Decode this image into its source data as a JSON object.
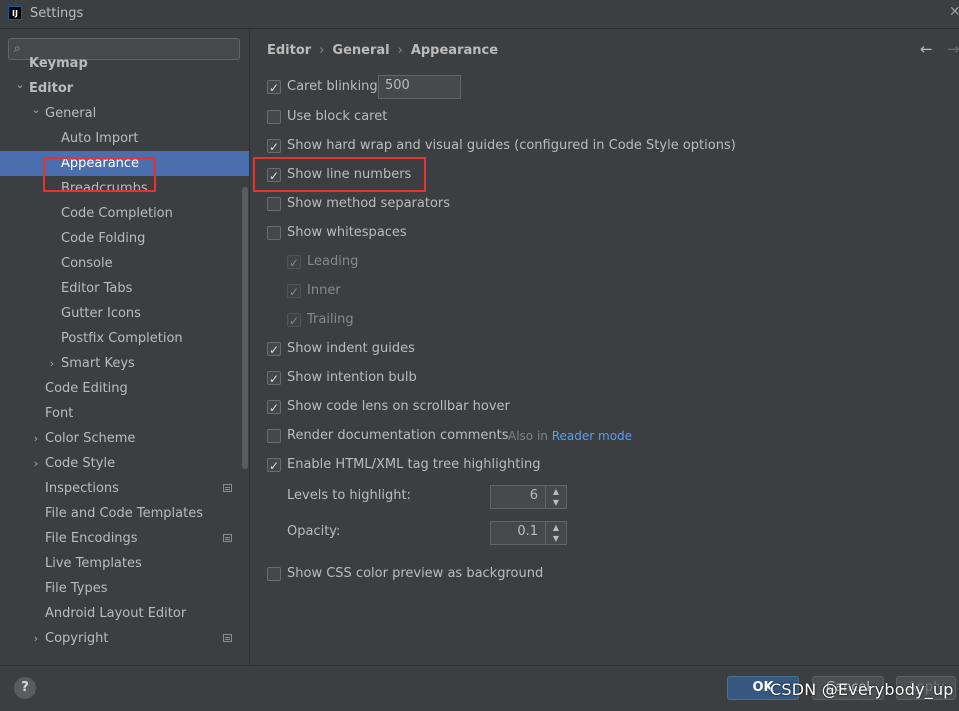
{
  "window": {
    "title": "Settings",
    "icon_text": "IJ"
  },
  "sidebar": {
    "search_placeholder": "",
    "items": [
      {
        "label": "Keymap",
        "bold": true,
        "level": 0,
        "arrow": "",
        "partial": true
      },
      {
        "label": "Editor",
        "bold": true,
        "level": 0,
        "arrow": "down"
      },
      {
        "label": "General",
        "level": 1,
        "arrow": "down"
      },
      {
        "label": "Auto Import",
        "level": 2
      },
      {
        "label": "Appearance",
        "level": 2,
        "selected": true
      },
      {
        "label": "Breadcrumbs",
        "level": 2
      },
      {
        "label": "Code Completion",
        "level": 2
      },
      {
        "label": "Code Folding",
        "level": 2
      },
      {
        "label": "Console",
        "level": 2
      },
      {
        "label": "Editor Tabs",
        "level": 2
      },
      {
        "label": "Gutter Icons",
        "level": 2
      },
      {
        "label": "Postfix Completion",
        "level": 2
      },
      {
        "label": "Smart Keys",
        "level": 2,
        "arrow": "right"
      },
      {
        "label": "Code Editing",
        "level": 1
      },
      {
        "label": "Font",
        "level": 1
      },
      {
        "label": "Color Scheme",
        "level": 1,
        "arrow": "right"
      },
      {
        "label": "Code Style",
        "level": 1,
        "arrow": "right"
      },
      {
        "label": "Inspections",
        "level": 1,
        "project_icon": true
      },
      {
        "label": "File and Code Templates",
        "level": 1
      },
      {
        "label": "File Encodings",
        "level": 1,
        "project_icon": true
      },
      {
        "label": "Live Templates",
        "level": 1
      },
      {
        "label": "File Types",
        "level": 1
      },
      {
        "label": "Android Layout Editor",
        "level": 1
      },
      {
        "label": "Copyright",
        "level": 1,
        "arrow": "right",
        "project_icon": true
      }
    ]
  },
  "breadcrumbs": [
    "Editor",
    "General",
    "Appearance"
  ],
  "options": {
    "caret_blinking": {
      "label": "Caret blinking (ms):",
      "checked": true,
      "value": "500"
    },
    "block_caret": {
      "label": "Use block caret",
      "checked": false
    },
    "hard_wrap": {
      "label": "Show hard wrap and visual guides (configured in Code Style options)",
      "checked": true
    },
    "line_numbers": {
      "label": "Show line numbers",
      "checked": true
    },
    "method_separators": {
      "label": "Show method separators",
      "checked": false
    },
    "whitespaces": {
      "label": "Show whitespaces",
      "checked": false
    },
    "leading": {
      "label": "Leading",
      "checked": true,
      "disabled": true
    },
    "inner": {
      "label": "Inner",
      "checked": true,
      "disabled": true
    },
    "trailing": {
      "label": "Trailing",
      "checked": true,
      "disabled": true
    },
    "indent_guides": {
      "label": "Show indent guides",
      "checked": true
    },
    "intention_bulb": {
      "label": "Show intention bulb",
      "checked": true
    },
    "code_lens": {
      "label": "Show code lens on scrollbar hover",
      "checked": true
    },
    "render_docs": {
      "label": "Render documentation comments",
      "checked": false,
      "hint": "Also in",
      "link": "Reader mode"
    },
    "tag_tree": {
      "label": "Enable HTML/XML tag tree highlighting",
      "checked": true
    },
    "levels": {
      "label": "Levels to highlight:",
      "value": "6"
    },
    "opacity": {
      "label": "Opacity:",
      "value": "0.1"
    },
    "css_preview": {
      "label": "Show CSS color preview as background",
      "checked": false
    }
  },
  "footer": {
    "help": "?",
    "ok": "OK",
    "cancel": "Cancel",
    "apply": "Apply"
  },
  "watermark": "CSDN @Everybody_up",
  "colors": {
    "background": "#3c3f41",
    "selection": "#4b6eaf",
    "highlight": "#e83232",
    "link": "#589df6"
  }
}
